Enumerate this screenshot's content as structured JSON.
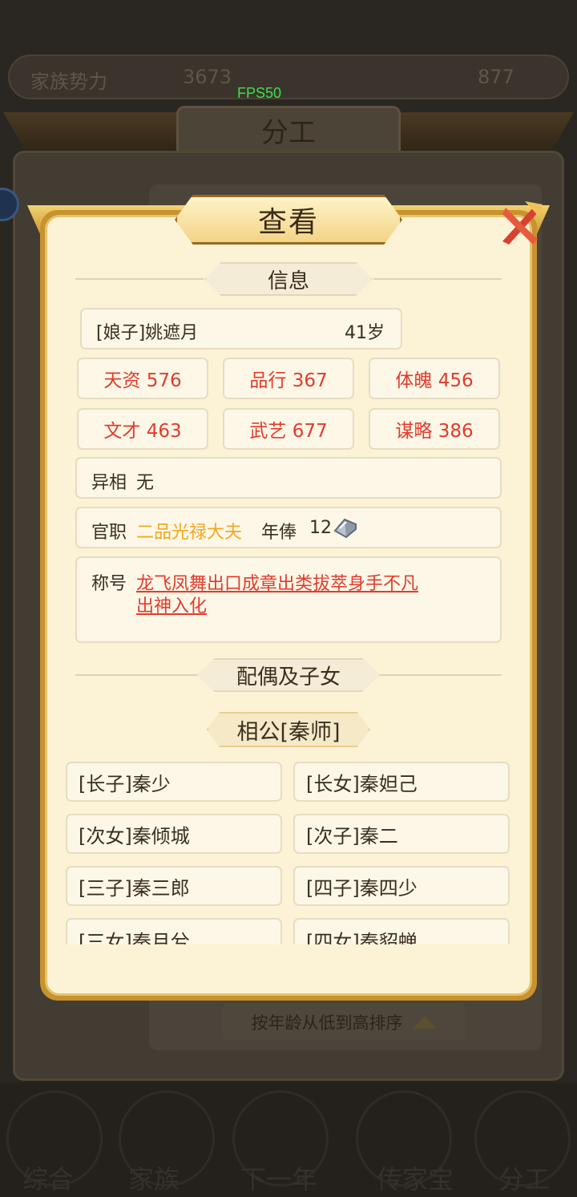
{
  "background": {
    "topbar": {
      "label": "家族势力",
      "value": "3673",
      "count": "877"
    },
    "fps": "FPS50",
    "title": "分工",
    "sort_label": "按年龄从低到高排序",
    "nav": [
      "综合",
      "家族",
      "下一年",
      "传家宝",
      "分工"
    ]
  },
  "modal": {
    "title": "查看",
    "info_header": "信息",
    "person": {
      "name": "[娘子]姚遮月",
      "age": "41岁"
    },
    "stats": [
      {
        "label": "天资 576"
      },
      {
        "label": "品行 367"
      },
      {
        "label": "体魄 456"
      },
      {
        "label": "文才 463"
      },
      {
        "label": "武艺 677"
      },
      {
        "label": "谋略 386"
      }
    ],
    "trait": {
      "label": "异相",
      "value": "无"
    },
    "office": {
      "label": "官职",
      "rank": "二品光禄大夫",
      "salary_label": "年俸",
      "salary_value": "12",
      "salary_icon": "silver-ingot-icon"
    },
    "titles": {
      "label": "称号",
      "line1": "龙飞凤舞出口成章出类拔萃身手不凡",
      "line2": "出神入化"
    },
    "family_header": "配偶及子女",
    "spouse": "相公[秦师]",
    "children": [
      "[长子]秦少",
      "[长女]秦妲己",
      "[次女]秦倾城",
      "[次子]秦二",
      "[三子]秦三郎",
      "[四子]秦四少",
      "[三女]秦月兮",
      "[四女]秦貂蝉"
    ]
  },
  "colors": {
    "stat_red": "#e23b2b",
    "rank_gold": "#f3a81a",
    "frame_gold": "#c8922e",
    "panel_cream": "#fcf3d6"
  }
}
